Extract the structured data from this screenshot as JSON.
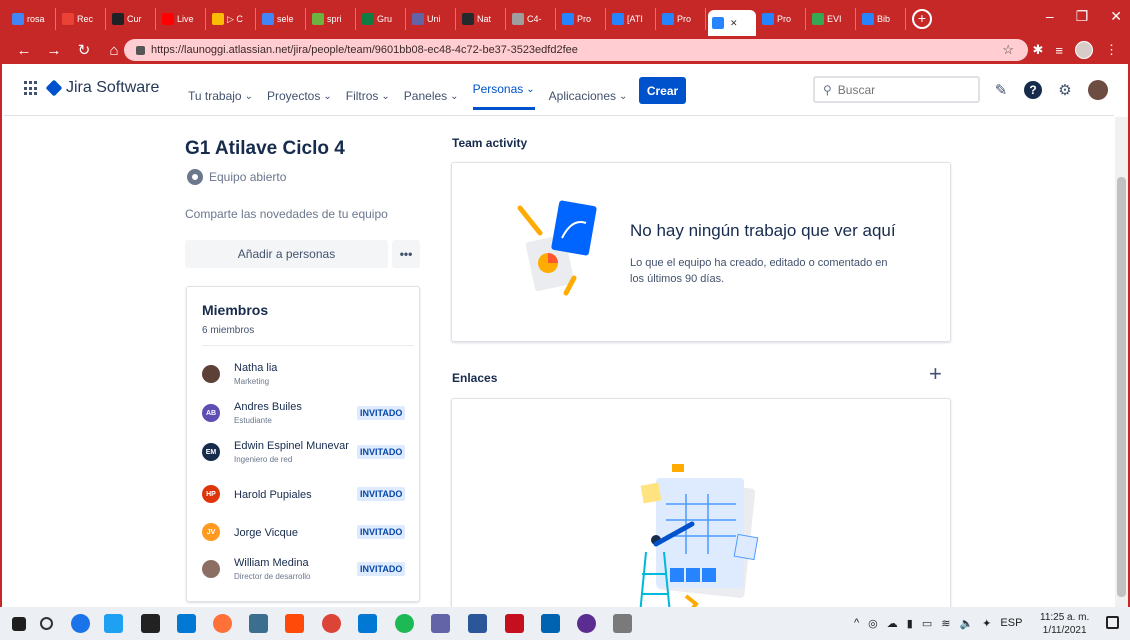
{
  "browser": {
    "tabs": [
      {
        "label": "rosa",
        "color": "#4285f4"
      },
      {
        "label": "Rec",
        "color": "#ea4335"
      },
      {
        "label": "Cur",
        "color": "#202124"
      },
      {
        "label": "Live",
        "color": "#ff0000"
      },
      {
        "label": "▷ C",
        "color": "#fbbc05"
      },
      {
        "label": "sele",
        "color": "#4285f4"
      },
      {
        "label": "spri",
        "color": "#6db33f"
      },
      {
        "label": "Gru",
        "color": "#107c41"
      },
      {
        "label": "Uni",
        "color": "#6264a7"
      },
      {
        "label": "Nat",
        "color": "#24292e"
      },
      {
        "label": "C4-",
        "color": "#9e9e9e"
      },
      {
        "label": "Pro",
        "color": "#2684ff"
      },
      {
        "label": "[ATI",
        "color": "#2684ff"
      },
      {
        "label": "Pro",
        "color": "#2684ff"
      },
      {
        "label": "",
        "color": "#2684ff",
        "active": true
      },
      {
        "label": "Pro",
        "color": "#2684ff"
      },
      {
        "label": "EVI",
        "color": "#34a853"
      },
      {
        "label": "Bib",
        "color": "#2684ff"
      }
    ],
    "url": "https://launoggi.atlassian.net/jira/people/team/9601bb08-ec48-4c72-be37-3523edfd2fee"
  },
  "nav": {
    "logo": "Jira Software",
    "menu": [
      "Tu trabajo",
      "Proyectos",
      "Filtros",
      "Paneles",
      "Personas",
      "Aplicaciones"
    ],
    "selected": "Personas",
    "create": "Crear",
    "search_placeholder": "Buscar"
  },
  "team": {
    "name": "G1 Atilave Ciclo 4",
    "visibility": "Equipo abierto",
    "share": "Comparte las novedades de tu equipo",
    "add_button": "Añadir a personas",
    "more": "•••"
  },
  "members": {
    "title": "Miembros",
    "count": "6 miembros",
    "list": [
      {
        "name": "Natha lia",
        "role": "Marketing",
        "initials": "",
        "color": "#5d4037",
        "badge": ""
      },
      {
        "name": "Andres Builes",
        "role": "Estudiante",
        "initials": "AB",
        "color": "#5e4db2",
        "badge": "INVITADO"
      },
      {
        "name": "Edwin Espinel Munevar",
        "role": "Ingeniero de red",
        "initials": "EM",
        "color": "#172b4d",
        "badge": "INVITADO"
      },
      {
        "name": "Harold Pupiales",
        "role": "",
        "initials": "HP",
        "color": "#de350b",
        "badge": "INVITADO"
      },
      {
        "name": "Jorge Vicque",
        "role": "",
        "initials": "JV",
        "color": "#ff991f",
        "badge": "INVITADO"
      },
      {
        "name": "William Medina",
        "role": "Director de desarrollo",
        "initials": "",
        "color": "#8d6e63",
        "badge": "INVITADO"
      }
    ]
  },
  "activity": {
    "heading": "Team activity",
    "empty_title": "No hay ningún trabajo que ver aquí",
    "empty_desc": "Lo que el equipo ha creado, editado o comentado en los últimos 90 días."
  },
  "links": {
    "heading": "Enlaces",
    "add": "+"
  },
  "taskbar": {
    "lang": "ESP",
    "time": "11:25 a. m.",
    "date": "1/11/2021"
  }
}
